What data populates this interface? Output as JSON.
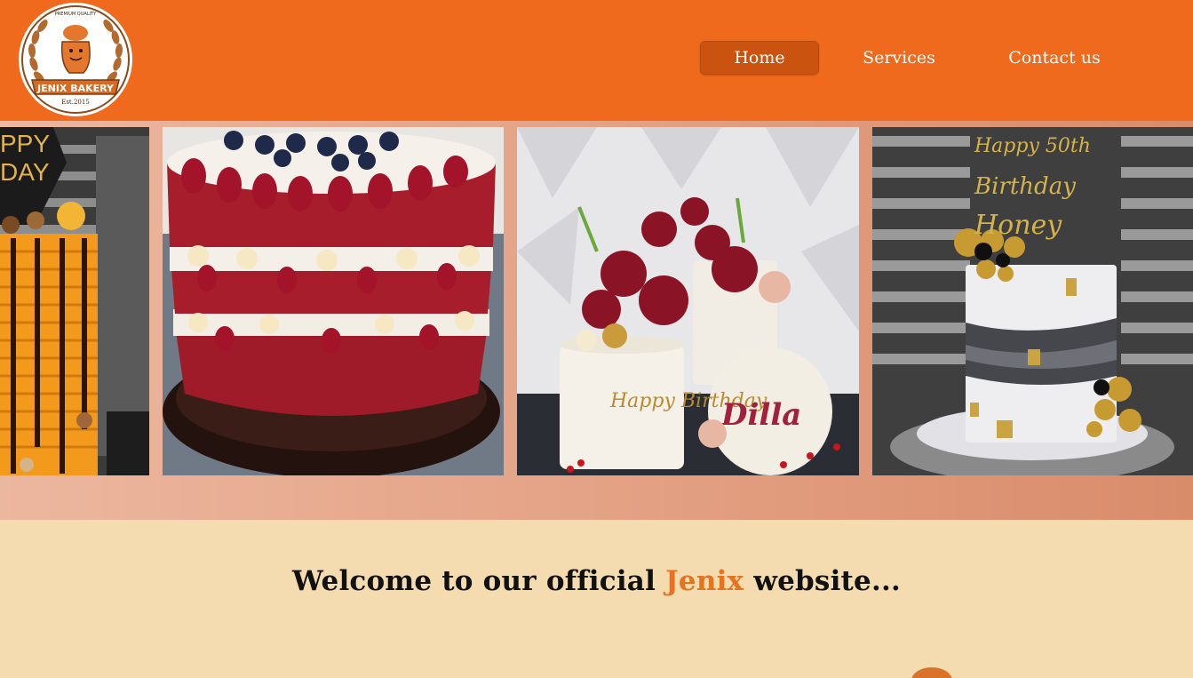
{
  "header": {
    "brand": "JENIX BAKERY",
    "tagline": "PREMIUM QUALITY",
    "established": "Est.2015",
    "nav": [
      {
        "label": "Home",
        "active": true
      },
      {
        "label": "Services",
        "active": false
      },
      {
        "label": "Contact us",
        "active": false
      }
    ]
  },
  "gallery": {
    "slides": [
      {
        "name": "orange-drip-cake",
        "topper_text": "PPY DAY"
      },
      {
        "name": "red-velvet-naked-cake"
      },
      {
        "name": "floral-birthday-cakes",
        "text_1": "Happy Birthday",
        "text_2": "Dilla"
      },
      {
        "name": "50th-birthday-cake",
        "topper_text": "Happy 50th Birthday Honey"
      }
    ]
  },
  "welcome": {
    "prefix": "Welcome to our official ",
    "highlight": "Jenix",
    "suffix": " website..."
  },
  "colors": {
    "header_bg": "#f06a1e",
    "nav_active_bg": "#c9530f",
    "page_bg": "#f5dcb0",
    "brand_accent": "#e5731f"
  }
}
